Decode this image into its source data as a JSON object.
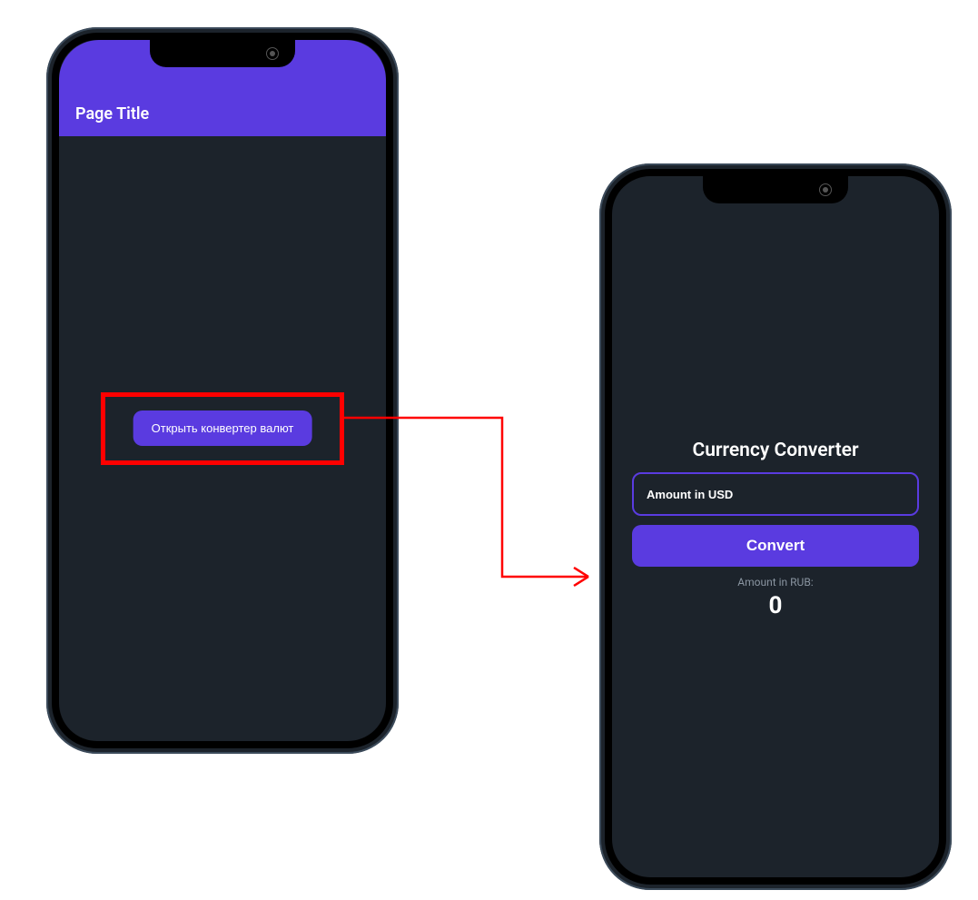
{
  "colors": {
    "accent": "#5a3be0",
    "background": "#1c232b",
    "highlight": "#ff0000"
  },
  "screen1": {
    "appbar_title": "Page Title",
    "open_button_label": "Открыть конвертер валют"
  },
  "screen2": {
    "title": "Currency Converter",
    "input_placeholder": "Amount in USD",
    "convert_label": "Convert",
    "result_label": "Amount in RUB:",
    "result_value": "0"
  }
}
